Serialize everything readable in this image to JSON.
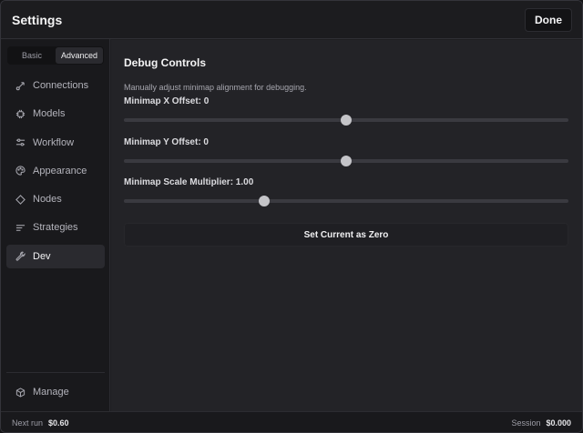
{
  "header": {
    "title": "Settings",
    "done_label": "Done"
  },
  "sidebar": {
    "modes": [
      {
        "label": "Basic",
        "active": false
      },
      {
        "label": "Advanced",
        "active": true
      }
    ],
    "items": [
      {
        "label": "Connections",
        "icon": "connection-icon",
        "active": false
      },
      {
        "label": "Models",
        "icon": "chip-icon",
        "active": false
      },
      {
        "label": "Workflow",
        "icon": "sliders-icon",
        "active": false
      },
      {
        "label": "Appearance",
        "icon": "palette-icon",
        "active": false
      },
      {
        "label": "Nodes",
        "icon": "diamond-icon",
        "active": false
      },
      {
        "label": "Strategies",
        "icon": "list-icon",
        "active": false
      },
      {
        "label": "Dev",
        "icon": "wrench-icon",
        "active": true
      }
    ],
    "manage": {
      "label": "Manage",
      "icon": "cube-icon"
    }
  },
  "main": {
    "section_title": "Debug Controls",
    "description": "Manually adjust minimap alignment for debugging.",
    "sliders": [
      {
        "label": "Minimap X Offset: 0",
        "fraction": 0.5
      },
      {
        "label": "Minimap Y Offset: 0",
        "fraction": 0.5
      },
      {
        "label": "Minimap Scale Multiplier: 1.00",
        "fraction": 0.316
      }
    ],
    "zero_button_label": "Set Current as Zero"
  },
  "footer": {
    "next_run_label": "Next run",
    "next_run_value": "$0.60",
    "session_label": "Session",
    "session_value": "$0.000"
  },
  "colors": {
    "background": "#1e1e21",
    "panel": "#232327",
    "active": "#2a2a2f",
    "thumb": "#c4c4c8"
  }
}
